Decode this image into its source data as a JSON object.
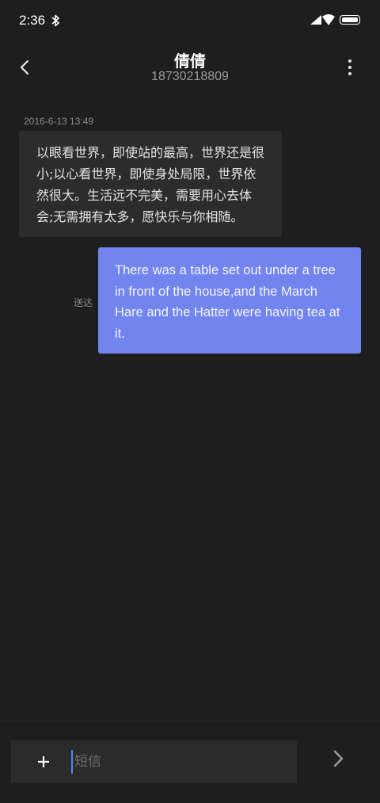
{
  "status_bar": {
    "time": "2:36",
    "icons": [
      "bluetooth-icon",
      "signal-icon",
      "wifi-icon",
      "battery-icon"
    ]
  },
  "header": {
    "contact_name": "倩倩",
    "contact_number": "18730218809",
    "back_icon": "chevron-left-icon",
    "more_icon": "more-vertical-icon"
  },
  "conversation": {
    "timestamp": "2016-6-13 13:49",
    "incoming_message": "以眼看世界，即使站的最高，世界还是很小;以心看世界，即使身处局限，世界依然很大。生活远不完美，需要用心去体会;无需拥有太多，愿快乐与你相随。",
    "outgoing_message": "There was a table set out under a tree in front of the house,and the March Hare and the Hatter were having tea at it.",
    "outgoing_status": "送达"
  },
  "composer": {
    "add_icon": "plus-icon",
    "input_value": "",
    "placeholder": "短信",
    "send_icon": "send-chevron-icon"
  },
  "colors": {
    "background": "#1e1e1e",
    "incoming_bubble": "#2c2c2c",
    "outgoing_bubble": "#7284ee",
    "cursor": "#4a8cf7"
  }
}
